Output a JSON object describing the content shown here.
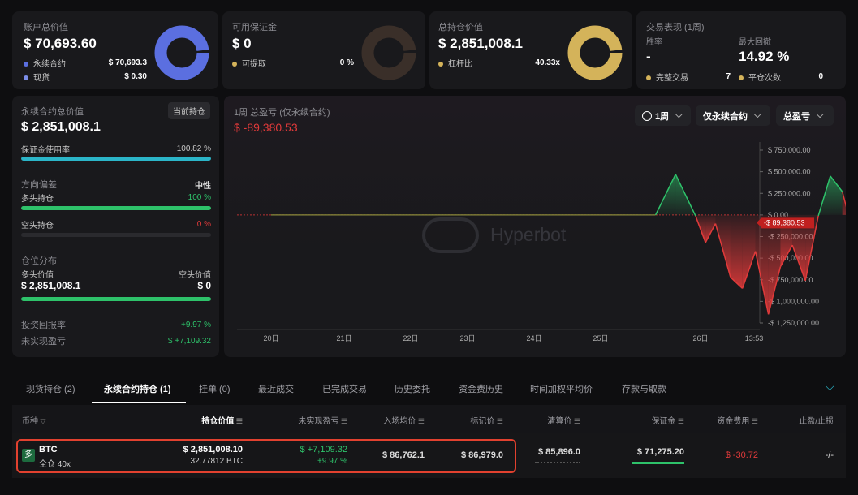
{
  "account": {
    "title": "账户总价值",
    "value": "$ 70,693.60",
    "items": [
      {
        "label": "永续合约",
        "value": "$ 70,693.3"
      },
      {
        "label": "现货",
        "value": "$ 0.30"
      }
    ]
  },
  "margin": {
    "title": "可用保证金",
    "value": "$ 0",
    "items": [
      {
        "label": "可提取",
        "value": "0 %"
      }
    ]
  },
  "position": {
    "title": "总持仓价值",
    "value": "$ 2,851,008.1",
    "items": [
      {
        "label": "杠杆比",
        "value": "40.33x"
      }
    ]
  },
  "performance": {
    "title": "交易表现 (1周)",
    "winrate_label": "胜率",
    "winrate_value": "-",
    "drawdown_label": "最大回撤",
    "drawdown_value": "14.92 %",
    "done_label": "完整交易",
    "done_value": "7",
    "close_label": "平仓次数",
    "close_value": "0"
  },
  "perp": {
    "title": "永续合约总价值",
    "badge": "当前持仓",
    "value": "$ 2,851,008.1",
    "margin_usage_label": "保证金使用率",
    "margin_usage_value": "100.82 %",
    "margin_usage_pct": 100,
    "direction_label": "方向偏差",
    "direction_value": "中性",
    "long_label": "多头持仓",
    "long_value": "100 %",
    "long_pct": 100,
    "short_label": "空头持仓",
    "short_value": "0 %",
    "short_pct": 0,
    "dist_label": "仓位分布",
    "long_val_label": "多头价值",
    "long_val": "$ 2,851,008.1",
    "short_val_label": "空头价值",
    "short_val": "$ 0",
    "dist_pct": 100,
    "roi_label": "投资回报率",
    "roi_value": "+9.97 %",
    "upnl_label": "未实现盈亏",
    "upnl_value": "$ +7,109.32"
  },
  "chart_header": {
    "title": "1周 总盈亏 (仅永续合约)",
    "value": "$ -89,380.53",
    "period": "1周",
    "filter": "仅永续合约",
    "metric": "总盈亏",
    "watermark": "Hyperbot"
  },
  "chart_data": {
    "type": "area",
    "x_labels": [
      "20日",
      "21日",
      "22日",
      "23日",
      "24日",
      "25日",
      "26日",
      "13:53"
    ],
    "y_ticks": [
      "$ 750,000.00",
      "$ 500,000.00",
      "$ 250,000.00",
      "$ 0.00",
      "-$ 250,000.00",
      "-$ 500,000.00",
      "-$ 750,000.00",
      "-$ 1,000,000.00",
      "-$ 1,250,000.00"
    ],
    "ylim": [
      -1250000,
      750000
    ],
    "current_label": "-$ 89,380.53",
    "x": [
      0,
      0.3,
      0.6,
      0.68,
      0.76,
      0.8,
      0.84,
      0.88,
      0.9,
      0.92,
      0.96,
      1.0,
      1.04,
      1.08,
      1.12,
      1.16,
      1.2,
      1.24,
      1.28,
      1.32,
      1.36,
      1.4,
      1.44,
      1.48,
      1.52
    ],
    "values": [
      0,
      0,
      0,
      0,
      0,
      0,
      0,
      0,
      0,
      0,
      0,
      0,
      0,
      0,
      0,
      0,
      0,
      0,
      0,
      0,
      0,
      0,
      0,
      0,
      -89380
    ],
    "points": [
      [
        0,
        0
      ],
      [
        5.3,
        0
      ],
      [
        5.55,
        0
      ],
      [
        5.75,
        470000
      ],
      [
        5.95,
        -10000
      ],
      [
        6.05,
        -320000
      ],
      [
        6.15,
        -100000
      ],
      [
        6.3,
        -720000
      ],
      [
        6.42,
        -850000
      ],
      [
        6.55,
        -420000
      ],
      [
        6.68,
        -1150000
      ],
      [
        6.8,
        -600000
      ],
      [
        6.92,
        -350000
      ],
      [
        7.05,
        -760000
      ],
      [
        7.18,
        -10000
      ],
      [
        7.3,
        450000
      ],
      [
        7.42,
        270000
      ],
      [
        7.55,
        -300000
      ],
      [
        7.68,
        -80000
      ],
      [
        7.8,
        -89380
      ]
    ]
  },
  "tabs": [
    "现货持仓 (2)",
    "永续合约持仓 (1)",
    "挂单 (0)",
    "最近成交",
    "已完成交易",
    "历史委托",
    "资金费历史",
    "时间加权平均价",
    "存款与取款"
  ],
  "table": {
    "headers": [
      "币种",
      "持仓价值",
      "未实现盈亏",
      "入场均价",
      "标记价",
      "清算价",
      "保证金",
      "资金费用",
      "止盈/止损"
    ],
    "row": {
      "icon": "多",
      "coin": "BTC",
      "sub": "全仓 40x",
      "pos_value": "$ 2,851,008.10",
      "pos_size": "32.77812 BTC",
      "upnl": "$ +7,109.32",
      "upnl_pct": "+9.97 %",
      "entry": "$ 86,762.1",
      "mark": "$ 86,979.0",
      "liq": "$ 85,896.0",
      "margin": "$ 71,275.20",
      "funding": "$ -30.72",
      "tpsl": "-/-"
    }
  },
  "colors": {
    "accent_blue": "#5b6fe0",
    "donut_empty": "#3a2f29",
    "donut_gold": "#d4b35a",
    "green": "#2ec26a",
    "red": "#e03a3a",
    "cyan": "#2bb5c8",
    "highlight": "#e2412f"
  }
}
